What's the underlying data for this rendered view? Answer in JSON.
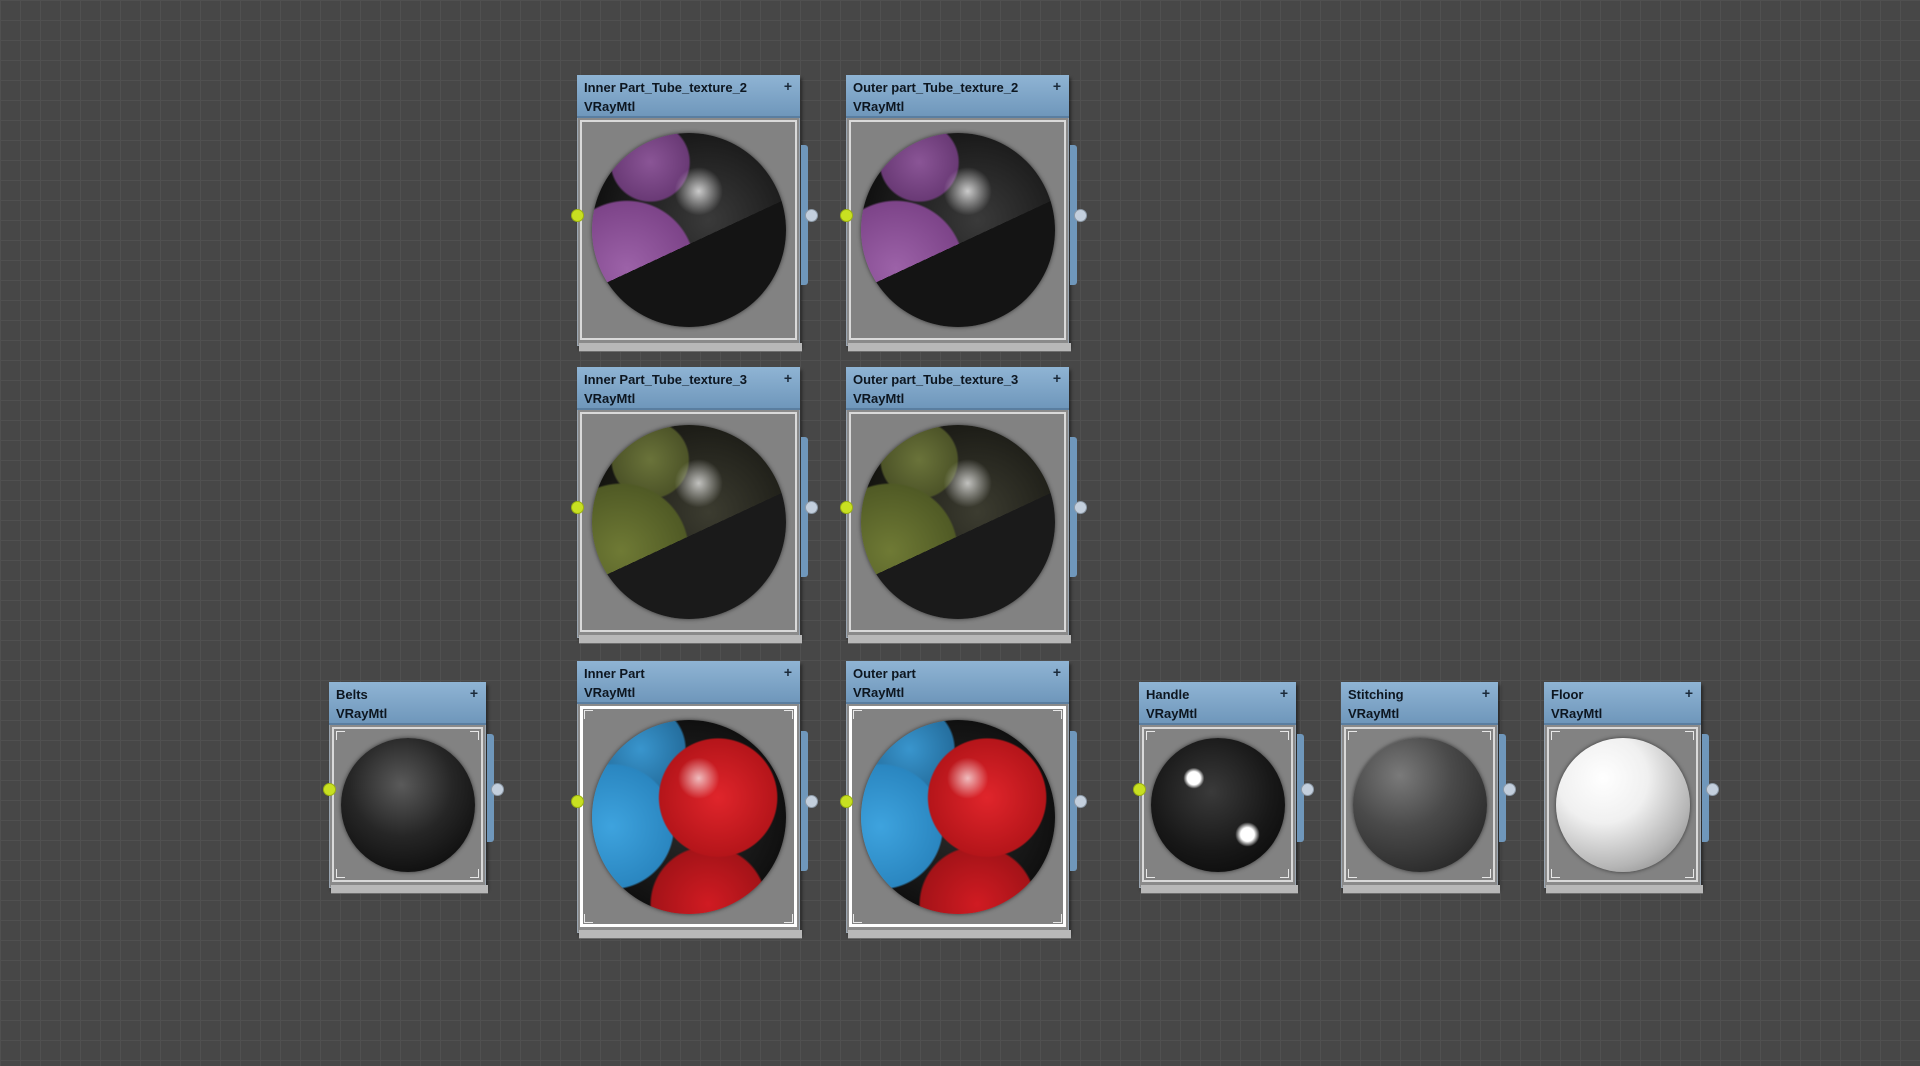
{
  "canvas": {
    "name": "Slate Material Editor view"
  },
  "nodes": [
    {
      "id": "n1",
      "name": "Inner Part_Tube_texture_2",
      "type": "VRayMtl",
      "material": "purple-texture",
      "action_icon": "+"
    },
    {
      "id": "n2",
      "name": "Outer part_Tube_texture_2",
      "type": "VRayMtl",
      "material": "purple-texture",
      "action_icon": "+"
    },
    {
      "id": "n3",
      "name": "Inner Part_Tube_texture_3",
      "type": "VRayMtl",
      "material": "camo-texture",
      "action_icon": "+"
    },
    {
      "id": "n4",
      "name": "Outer part_Tube_texture_3",
      "type": "VRayMtl",
      "material": "camo-texture",
      "action_icon": "+"
    },
    {
      "id": "n5",
      "name": "Belts",
      "type": "VRayMtl",
      "material": "dark-gray",
      "action_icon": "+"
    },
    {
      "id": "n6",
      "name": "Inner Part",
      "type": "VRayMtl",
      "material": "red-blue",
      "action_icon": "+"
    },
    {
      "id": "n7",
      "name": "Outer part",
      "type": "VRayMtl",
      "material": "red-blue",
      "action_icon": "+"
    },
    {
      "id": "n8",
      "name": "Handle",
      "type": "VRayMtl",
      "material": "glossy-black",
      "action_icon": "+"
    },
    {
      "id": "n9",
      "name": "Stitching",
      "type": "VRayMtl",
      "material": "mid-gray",
      "action_icon": "+"
    },
    {
      "id": "n10",
      "name": "Floor",
      "type": "VRayMtl",
      "material": "white",
      "action_icon": "+"
    }
  ],
  "colors": {
    "header": "#7fa6c8",
    "input_socket": "#c8e021",
    "output_socket": "#c3cfdd",
    "background": "#474747"
  }
}
